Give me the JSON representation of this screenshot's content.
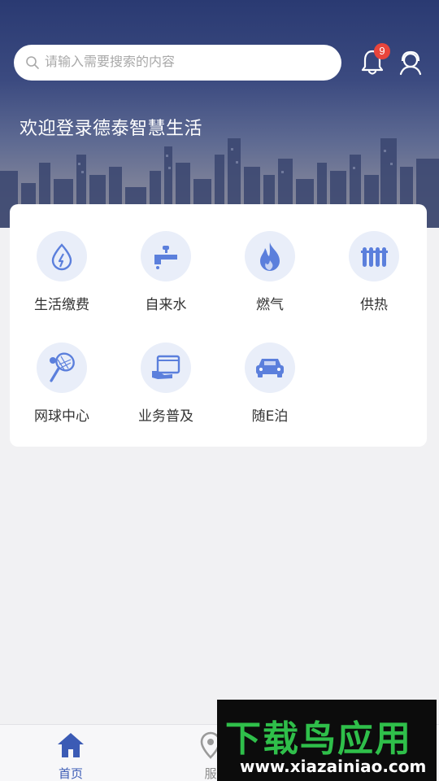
{
  "header": {
    "search_placeholder": "请输入需要搜索的内容",
    "notification_count": "9",
    "welcome_text": "欢迎登录德泰智慧生活"
  },
  "services": [
    {
      "label": "生活缴费",
      "icon": "utility-payment-icon"
    },
    {
      "label": "自来水",
      "icon": "water-tap-icon"
    },
    {
      "label": "燃气",
      "icon": "gas-flame-icon"
    },
    {
      "label": "供热",
      "icon": "radiator-icon"
    },
    {
      "label": "网球中心",
      "icon": "tennis-racket-icon"
    },
    {
      "label": "业务普及",
      "icon": "business-guide-icon"
    },
    {
      "label": "随E泊",
      "icon": "parking-car-icon"
    }
  ],
  "tabbar": {
    "tabs": [
      {
        "label": "首页",
        "icon": "home-icon",
        "active": true
      },
      {
        "label": "服",
        "icon": "location-pin-icon",
        "active": false
      }
    ]
  },
  "watermark": {
    "title": "下载鸟应用",
    "url": "www.xiazainiao.com"
  },
  "colors": {
    "accent": "#3b5bb5",
    "icon_blue": "#5b7fdc",
    "icon_bg": "#e9eef9",
    "badge": "#e8453c",
    "watermark_green": "#2fbf4a"
  }
}
